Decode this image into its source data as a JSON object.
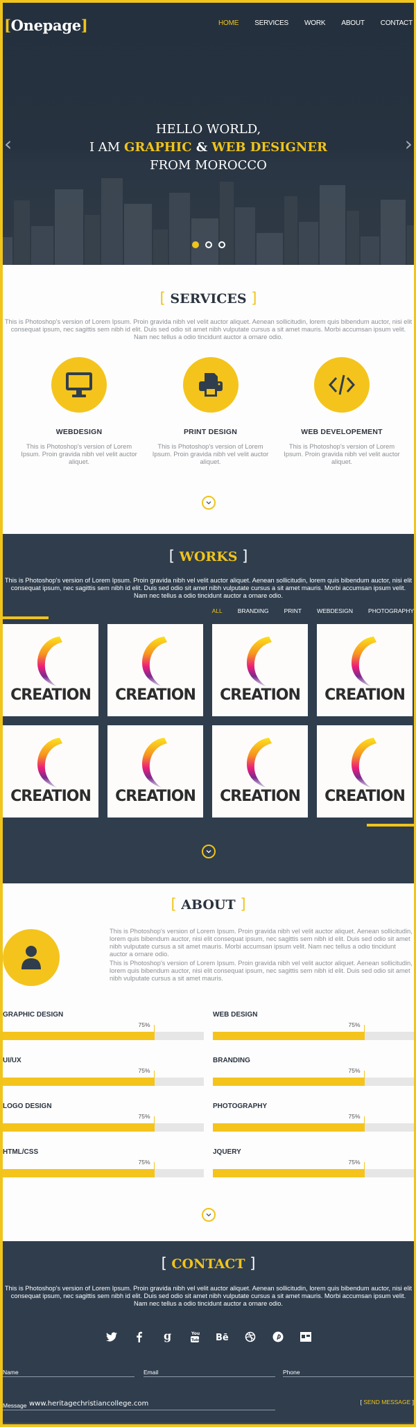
{
  "header": {
    "logo": {
      "bracket_open": "[",
      "text": "Onepage",
      "bracket_close": "]"
    },
    "nav": [
      {
        "label": "HOME",
        "active": true
      },
      {
        "label": "SERVICES",
        "active": false
      },
      {
        "label": "WORK",
        "active": false
      },
      {
        "label": "ABOUT",
        "active": false
      },
      {
        "label": "CONTACT",
        "active": false
      }
    ]
  },
  "hero": {
    "line1": "HELLO WORLD,",
    "line2_prefix": "I AM ",
    "line2_highlight1": "GRAPHIC",
    "line2_amp": " & ",
    "line2_highlight2": "WEB DESIGNER",
    "line3": "FROM MOROCCO",
    "prev_icon": "chevron-left",
    "next_icon": "chevron-right",
    "slides": 3,
    "active_slide": 1
  },
  "lorem": "This is Photoshop's version  of Lorem Ipsum. Proin gravida nibh vel velit auctor aliquet. Aenean sollicitudin, lorem quis bibendum auctor, nisi elit consequat ipsum, nec sagittis sem nibh id elit. Duis sed odio sit amet nibh vulputate cursus a sit amet mauris. Morbi accumsan ipsum velit. Nam nec tellus a odio tincidunt auctor a ornare odio.",
  "services": {
    "title": "SERVICES",
    "bracket_open": "[",
    "bracket_close": "]",
    "items": [
      {
        "icon": "monitor-icon",
        "name": "WEBDESIGN",
        "desc": "This is Photoshop's version  of Lorem Ipsum. Proin gravida nibh vel velit auctor aliquet."
      },
      {
        "icon": "printer-icon",
        "name": "PRINT DESIGN",
        "desc": "This is Photoshop's version  of Lorem Ipsum. Proin gravida nibh vel velit auctor aliquet."
      },
      {
        "icon": "code-icon",
        "name": "WEB DEVELOPEMENT",
        "desc": "This is Photoshop's version  of Lorem Ipsum. Proin gravida nibh vel velit auctor aliquet."
      }
    ]
  },
  "works": {
    "title": "WORKS",
    "bracket_open": "[",
    "bracket_close": "]",
    "filters": [
      {
        "label": "ALL",
        "active": true
      },
      {
        "label": "BRANDING",
        "active": false
      },
      {
        "label": "PRINT",
        "active": false
      },
      {
        "label": "WEBDESIGN",
        "active": false
      },
      {
        "label": "PHOTOGRAPHY",
        "active": false
      }
    ],
    "items": [
      {
        "caption": "CREATION"
      },
      {
        "caption": "CREATION"
      },
      {
        "caption": "CREATION"
      },
      {
        "caption": "CREATION"
      },
      {
        "caption": "CREATION"
      },
      {
        "caption": "CREATION"
      },
      {
        "caption": "CREATION"
      },
      {
        "caption": "CREATION"
      }
    ]
  },
  "about": {
    "title": "ABOUT",
    "bracket_open": "[",
    "bracket_close": "]",
    "paragraph1": "This is Photoshop's version  of Lorem Ipsum. Proin gravida nibh vel velit auctor aliquet. Aenean sollicitudin, lorem quis bibendum auctor, nisi elit consequat ipsum, nec sagittis sem nibh id elit. Duis sed odio sit amet nibh vulputate cursus a sit amet mauris. Morbi accumsan ipsum velit. Nam nec tellus a odio tincidunt auctor a ornare odio.",
    "paragraph2": "This is Photoshop's version  of Lorem Ipsum. Proin gravida nibh vel velit auctor aliquet. Aenean sollicitudin, lorem quis bibendum auctor, nisi elit consequat ipsum, nec sagittis sem nibh id elit. Duis sed odio sit amet nibh vulputate cursus a sit amet mauris.",
    "skills": [
      {
        "name": "GRAPHIC DESIGN",
        "percent": 75,
        "label": "75%"
      },
      {
        "name": "WEB DESIGN",
        "percent": 75,
        "label": "75%"
      },
      {
        "name": "UI/UX",
        "percent": 75,
        "label": "75%"
      },
      {
        "name": "BRANDING",
        "percent": 75,
        "label": "75%"
      },
      {
        "name": "LOGO DESIGN",
        "percent": 75,
        "label": "75%"
      },
      {
        "name": "PHOTOGRAPHY",
        "percent": 75,
        "label": "75%"
      },
      {
        "name": "HTML/CSS",
        "percent": 75,
        "label": "75%"
      },
      {
        "name": " JQUERY",
        "percent": 75,
        "label": "75%"
      }
    ]
  },
  "contact": {
    "title": "CONTACT",
    "bracket_open": "[",
    "bracket_close": "]",
    "social": [
      "twitter-icon",
      "facebook-icon",
      "google-icon",
      "youtube-icon",
      "behance-icon",
      "dribbble-icon",
      "pinterest-icon",
      "deviantart-icon"
    ],
    "social_glyphs": [
      "🐦",
      "f",
      "g",
      "▶",
      "Bē",
      "◎",
      "℗",
      "▣"
    ],
    "form": {
      "name_placeholder": "Name",
      "email_placeholder": "Email",
      "phone_placeholder": "Phone",
      "message_placeholder": "Message",
      "message_value": "www.heritagechristiancollege.com",
      "send_open": "[ ",
      "send_label": "SEND MESSAGE",
      "send_close": " ]"
    }
  },
  "colors": {
    "accent": "#f0c41b",
    "dark": "#2f3d4d",
    "light": "#fdfdfd",
    "text_dark": "#2b3440",
    "text_muted": "#8b8f94"
  }
}
